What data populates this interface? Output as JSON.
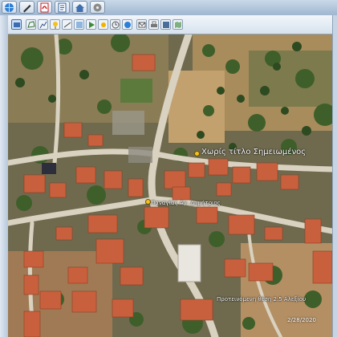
{
  "taskbar": {
    "icons": [
      {
        "name": "ie-globe-icon",
        "color": "#2b7fd6"
      },
      {
        "name": "pencil-tool-icon",
        "color": "#2d2d2d"
      },
      {
        "name": "pdf-icon",
        "color": "#c81e1e"
      },
      {
        "name": "text-editor-icon",
        "color": "#2f5f9f"
      },
      {
        "name": "home-folder-icon",
        "color": "#3f6fae"
      },
      {
        "name": "media-icon",
        "color": "#5a5a5a"
      }
    ]
  },
  "toolbar": {
    "tools": [
      "layers-icon",
      "polygon-icon",
      "path-icon",
      "placemark-icon",
      "measure-icon",
      "overlay-icon",
      "tour-icon",
      "sun-icon",
      "history-icon",
      "planet-icon",
      "email-icon",
      "print-icon",
      "save-image-icon",
      "map-view-icon"
    ]
  },
  "map": {
    "labels": {
      "main": "Χωρίς τίτλο Σημειωμένος",
      "street": "Παναγίας Αγ. Δημήτριος",
      "bottom": "Προτεινόμενη θέση 2.5 Αλεξίου"
    },
    "status": "2/28/2020",
    "colors": {
      "roof": "#c9603d",
      "road": "#d9d2c1",
      "field": "#c9a47a",
      "vegetation": "#3f5f2a",
      "pin": "#f4c21f"
    }
  }
}
